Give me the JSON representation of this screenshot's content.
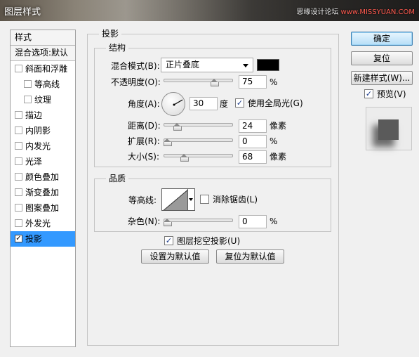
{
  "window": {
    "title": "图层样式",
    "watermark_prefix": "思缘设计论坛 ",
    "watermark_site": "www.MISSYUAN.COM"
  },
  "stylelist": {
    "header": "样式",
    "blend_options": "混合选项:默认",
    "items": [
      {
        "label": "斜面和浮雕",
        "checked": false,
        "sub": false
      },
      {
        "label": "等高线",
        "checked": false,
        "sub": true
      },
      {
        "label": "纹理",
        "checked": false,
        "sub": true
      },
      {
        "label": "描边",
        "checked": false,
        "sub": false
      },
      {
        "label": "内阴影",
        "checked": false,
        "sub": false
      },
      {
        "label": "内发光",
        "checked": false,
        "sub": false
      },
      {
        "label": "光泽",
        "checked": false,
        "sub": false
      },
      {
        "label": "颜色叠加",
        "checked": false,
        "sub": false
      },
      {
        "label": "渐变叠加",
        "checked": false,
        "sub": false
      },
      {
        "label": "图案叠加",
        "checked": false,
        "sub": false
      },
      {
        "label": "外发光",
        "checked": false,
        "sub": false
      },
      {
        "label": "投影",
        "checked": true,
        "sub": false
      }
    ]
  },
  "drop_shadow": {
    "title": "投影",
    "structure": {
      "title": "结构",
      "blend_mode_label": "混合模式(B):",
      "blend_mode_value": "正片叠底",
      "blend_color": "#000000",
      "opacity_label": "不透明度(O):",
      "opacity_value": "75",
      "opacity_unit": "%",
      "angle_label": "角度(A):",
      "angle_value": "30",
      "angle_unit": "度",
      "global_light_label": "使用全局光(G)",
      "global_light_checked": true,
      "distance_label": "距离(D):",
      "distance_value": "24",
      "distance_unit": "像素",
      "spread_label": "扩展(R):",
      "spread_value": "0",
      "spread_unit": "%",
      "size_label": "大小(S):",
      "size_value": "68",
      "size_unit": "像素"
    },
    "quality": {
      "title": "品质",
      "contour_label": "等高线:",
      "antialias_label": "消除锯齿(L)",
      "antialias_checked": false,
      "noise_label": "杂色(N):",
      "noise_value": "0",
      "noise_unit": "%"
    },
    "knockout_label": "图层挖空投影(U)",
    "knockout_checked": true,
    "make_default": "设置为默认值",
    "reset_default": "复位为默认值"
  },
  "buttons": {
    "ok": "确定",
    "reset": "复位",
    "new_style": "新建样式(W)...",
    "preview_label": "预览(V)",
    "preview_checked": true
  },
  "colors": {
    "selection": "#3399ff",
    "default_button": "#b6def7"
  }
}
